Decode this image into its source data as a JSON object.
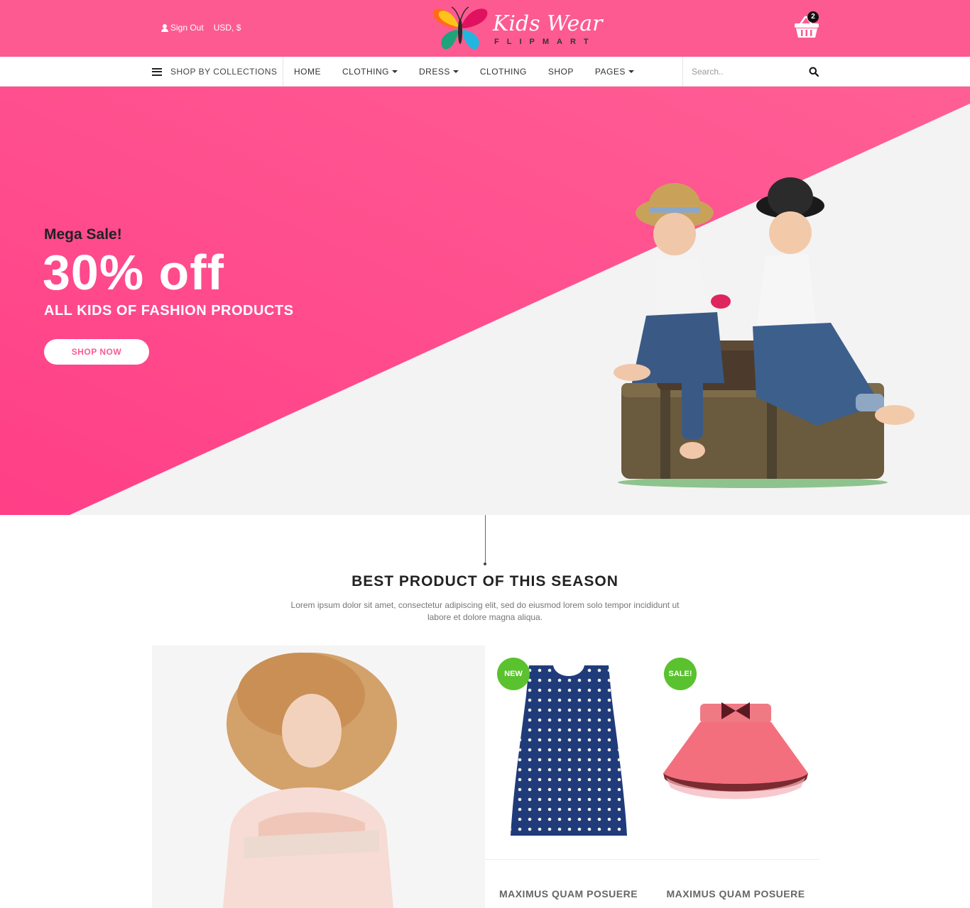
{
  "header": {
    "sign_out": "Sign Out",
    "currency": "USD, $",
    "logo_title": "Kids Wear",
    "logo_sub": "FLIPMART",
    "cart_count": "2"
  },
  "nav": {
    "collections": "SHOP BY COLLECTIONS",
    "items": [
      {
        "label": "HOME"
      },
      {
        "label": "CLOTHING"
      },
      {
        "label": "DRESS"
      },
      {
        "label": "CLOTHING"
      },
      {
        "label": "SHOP"
      },
      {
        "label": "PAGES"
      }
    ],
    "search_placeholder": "Search.."
  },
  "hero": {
    "pre": "Mega Sale!",
    "big": "30% off",
    "sub": "ALL KIDS OF FASHION PRODUCTS",
    "button": "SHOP NOW"
  },
  "section": {
    "title": "BEST PRODUCT OF THIS SEASON",
    "desc": "Lorem ipsum dolor sit amet, consectetur adipiscing elit, sed do eiusmod lorem solo tempor incididunt ut labore et dolore magna aliqua."
  },
  "products": [
    {
      "badge": "NEW",
      "name": "MAXIMUS QUAM POSUERE"
    },
    {
      "badge": "SALE!",
      "name": "MAXIMUS QUAM POSUERE"
    }
  ],
  "colors": {
    "brand_pink": "#fd5a91",
    "badge_green": "#59c22e"
  }
}
